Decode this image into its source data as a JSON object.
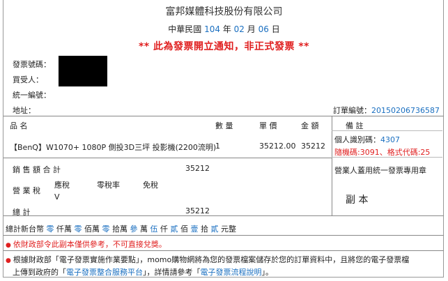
{
  "company": "富邦媒體科技股份有限公司",
  "date": {
    "era": "中華民國",
    "year": "104",
    "year_unit": "年",
    "month": "02",
    "month_unit": "月",
    "day": "06",
    "day_unit": "日"
  },
  "notice": "** 此為發票開立通知，非正式發票 **",
  "fields": {
    "invoice_no_label": "發票號碼：",
    "buyer_label": "買受人：",
    "tax_id_label": "統一編號：",
    "address_label": "地址：",
    "order_no_label": "訂單編號：",
    "order_no": "20150206736587"
  },
  "table_headers": {
    "item": "品  名",
    "qty": "數  量",
    "unit_price": "單  價",
    "amount": "金  額",
    "remark": "備  註"
  },
  "item": {
    "name": "【BenQ】W1070+ 1080P 側投3D三坪 投影機(2200流明)",
    "qty": "1",
    "unit_price": "35212.00",
    "amount": "35212"
  },
  "remark": {
    "personal_id_label": "個人識別碼：",
    "personal_id": "4307",
    "random_code": "隨機碼:3091、格式代碼:25",
    "stamp_label": "營業人蓋用統一發票專用章",
    "copy_label": "副  本"
  },
  "totals": {
    "sales_label": "銷 售 額 合 計",
    "sales": "35212",
    "tax_label": "營 業 稅",
    "taxable": "應稅",
    "zero_rate": "零稅率",
    "exempt": "免稅",
    "check": "V",
    "total_label": "總  計",
    "total": "35212"
  },
  "amount_words": {
    "prefix": "總計新台幣",
    "parts": [
      [
        "零",
        "仟萬"
      ],
      [
        "零",
        "佰萬"
      ],
      [
        "零",
        "拾萬"
      ],
      [
        "參",
        "萬"
      ],
      [
        "伍",
        "仟"
      ],
      [
        "貳",
        "佰"
      ],
      [
        "壹",
        "拾"
      ],
      [
        "貳",
        "元整"
      ]
    ]
  },
  "footnotes": {
    "note1": "依財政部令此副本僅供參考，不可直接兌獎。",
    "note2_a": "根據財政部「電子發票實施作業要點」，momo購物網將為您的發票檔案儲存於您的訂單資料中，且將您的電子發票檔",
    "note2_b_pre": "上傳到政府的「",
    "link1": "電子發票整合服務平台",
    "note2_b_mid": "」，詳情請參考「",
    "link2": "電子發票流程說明",
    "note2_b_post": "」。"
  },
  "colors": {
    "accent_blue": "#1a6fc0",
    "alert_red": "#e02020"
  }
}
